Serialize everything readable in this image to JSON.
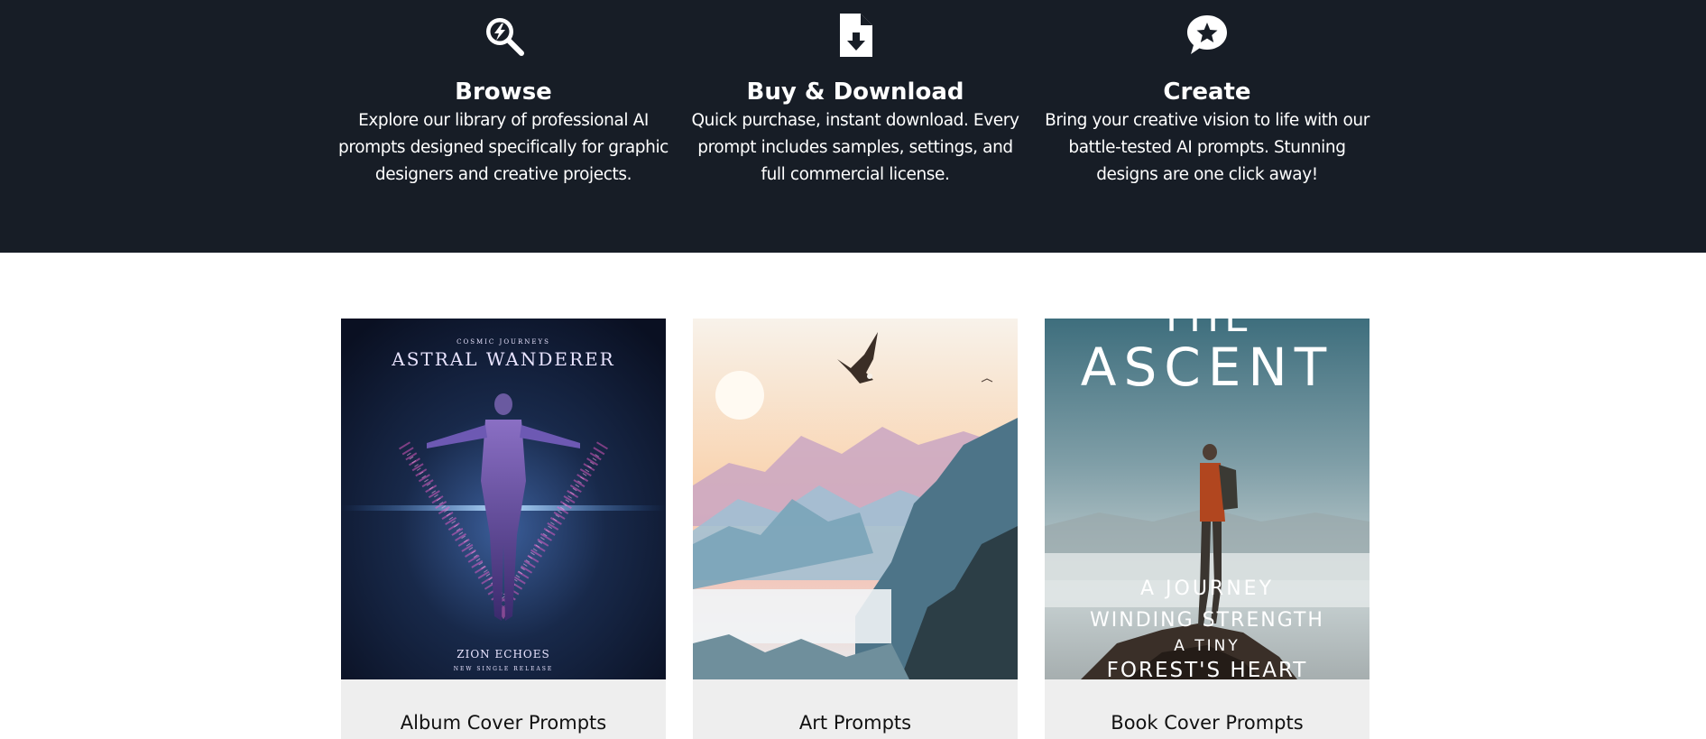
{
  "features": [
    {
      "icon": "magnifier-lightning-icon",
      "title": "Browse",
      "description": "Explore our library of professional AI prompts designed specifically for graphic designers and creative projects."
    },
    {
      "icon": "file-download-icon",
      "title": "Buy & Download",
      "description": "Quick purchase, instant download. Every prompt includes samples, settings, and full commercial license."
    },
    {
      "icon": "star-speech-bubble-icon",
      "title": "Create",
      "description": "Bring your creative vision to life with our battle-tested AI prompts. Stunning designs are one click away!"
    }
  ],
  "categories": [
    {
      "label": "Album Cover Prompts",
      "art": {
        "top_text": "COSMIC JOURNEYS",
        "title": "ASTRAL WANDERER",
        "artist": "ZION ECHOES",
        "subtitle": "NEW SINGLE RELEASE"
      }
    },
    {
      "label": "Art Prompts"
    },
    {
      "label": "Book Cover Prompts",
      "art": {
        "title_partial": "THE",
        "title": "ASCENT",
        "line1": "A JOURNEY",
        "line2": "WINDING STRENGTH",
        "line3": "A TINY",
        "line4": "FOREST'S HEART"
      }
    }
  ],
  "colors": {
    "hero_background": "#171d26",
    "card_background": "#eeeeee"
  }
}
